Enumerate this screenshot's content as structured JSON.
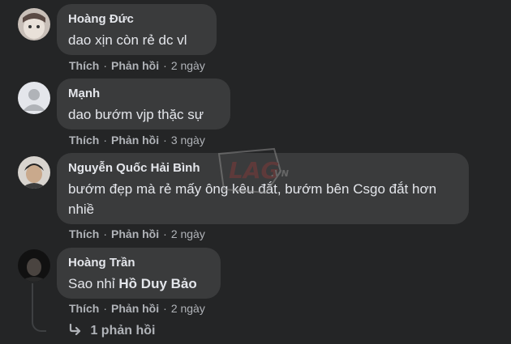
{
  "comments": [
    {
      "author": "Hoàng Đức",
      "text": "dao xịn còn rẻ dc vl",
      "like": "Thích",
      "reply": "Phản hồi",
      "time": "2 ngày"
    },
    {
      "author": "Mạnh",
      "text": "dao bướm vjp thặc sự",
      "like": "Thích",
      "reply": "Phản hồi",
      "time": "3 ngày"
    },
    {
      "author": "Nguyễn Quốc Hải Bình",
      "text": "bướm đẹp mà rẻ mấy ông kêu đắt, bướm bên Csgo đắt hơn nhiề",
      "like": "Thích",
      "reply": "Phản hồi",
      "time": "2 ngày"
    },
    {
      "author": "Hoàng Trần",
      "text_before": "Sao nhỉ",
      "mention": "Hồ Duy Bảo",
      "like": "Thích",
      "reply": "Phản hồi",
      "time": "2 ngày"
    }
  ],
  "replies_link": "1 phản hồi",
  "separator": "·",
  "icons": {
    "reply_arrow": "reply-arrow-icon"
  },
  "watermark": {
    "logo": "LAG",
    "suffix": ".VN"
  },
  "colors": {
    "background": "#242526",
    "bubble": "#3a3b3c",
    "text": "#e4e6eb",
    "muted": "#b0b3b8"
  }
}
